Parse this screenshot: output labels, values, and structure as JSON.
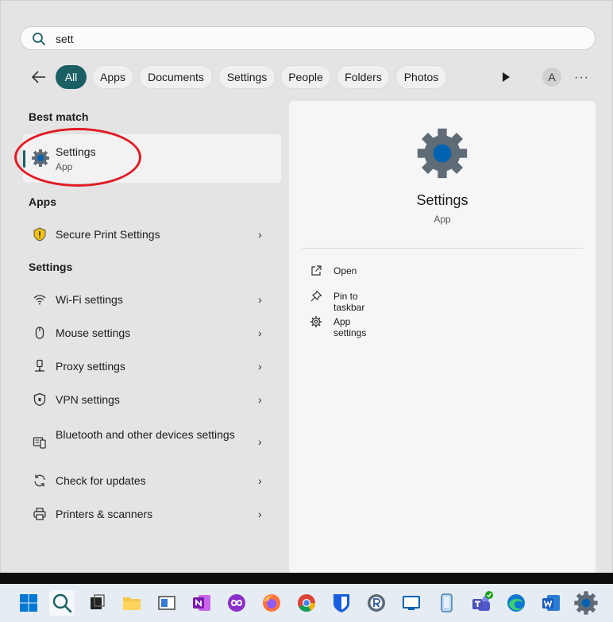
{
  "search": {
    "value": "sett",
    "icon": "search-icon"
  },
  "filters": [
    "All",
    "Apps",
    "Documents",
    "Settings",
    "People",
    "Folders",
    "Photos"
  ],
  "toolbar": {
    "avatar_letter": "A",
    "more": "···"
  },
  "best_match": {
    "heading": "Best match",
    "title": "Settings",
    "subtitle": "App"
  },
  "apps": {
    "heading": "Apps",
    "items": [
      {
        "label": "Secure Print Settings"
      }
    ]
  },
  "settings": {
    "heading": "Settings",
    "items": [
      {
        "label": "Wi-Fi settings"
      },
      {
        "label": "Mouse settings"
      },
      {
        "label": "Proxy settings"
      },
      {
        "label": "VPN settings"
      },
      {
        "label": "Bluetooth and other devices settings"
      },
      {
        "label": "Check for updates"
      },
      {
        "label": "Printers & scanners"
      }
    ]
  },
  "detail": {
    "title": "Settings",
    "subtitle": "App",
    "actions": [
      {
        "label": "Open"
      },
      {
        "label": "Pin to taskbar"
      },
      {
        "label": "App settings"
      }
    ]
  },
  "colors": {
    "accent": "#1b5f63",
    "highlight": "#e01b24",
    "gear_blue": "#0063b1"
  }
}
